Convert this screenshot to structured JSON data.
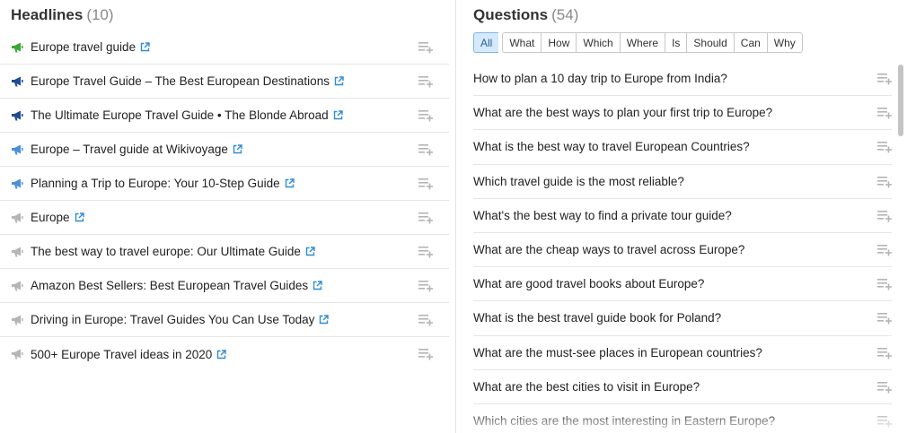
{
  "headlines": {
    "title": "Headlines",
    "count": "(10)",
    "items": [
      {
        "text": "Europe travel guide",
        "icon": "megaphone-green-icon",
        "color": "#3aa635"
      },
      {
        "text": "Europe Travel Guide – The Best European Destinations",
        "icon": "megaphone-navy-icon",
        "color": "#1f4d8f"
      },
      {
        "text": "The Ultimate Europe Travel Guide • The Blonde Abroad",
        "icon": "megaphone-navy-icon",
        "color": "#1f4d8f"
      },
      {
        "text": "Europe – Travel guide at Wikivoyage",
        "icon": "megaphone-blue-icon",
        "color": "#4a90d9"
      },
      {
        "text": "Planning a Trip to Europe: Your 10-Step Guide",
        "icon": "megaphone-blue-icon",
        "color": "#4a90d9"
      },
      {
        "text": "Europe",
        "icon": "megaphone-gray-icon",
        "color": "#b5b5b5"
      },
      {
        "text": "The best way to travel europe: Our Ultimate Guide",
        "icon": "megaphone-gray-icon",
        "color": "#b5b5b5"
      },
      {
        "text": "Amazon Best Sellers: Best European Travel Guides",
        "icon": "megaphone-gray-icon",
        "color": "#b5b5b5"
      },
      {
        "text": "Driving in Europe: Travel Guides You Can Use Today",
        "icon": "megaphone-gray-icon",
        "color": "#b5b5b5"
      },
      {
        "text": "500+ Europe Travel ideas in 2020",
        "icon": "megaphone-gray-icon",
        "color": "#b5b5b5"
      }
    ]
  },
  "questions": {
    "title": "Questions",
    "count": "(54)",
    "filters": [
      "All",
      "What",
      "How",
      "Which",
      "Where",
      "Is",
      "Should",
      "Can",
      "Why"
    ],
    "active_filter": "All",
    "items": [
      "How to plan a 10 day trip to Europe from India?",
      "What are the best ways to plan your first trip to Europe?",
      "What is the best way to travel European Countries?",
      "Which travel guide is the most reliable?",
      "What's the best way to find a private tour guide?",
      "What are the cheap ways to travel across Europe?",
      "What are good travel books about Europe?",
      "What is the best travel guide book for Poland?",
      "What are the must-see places in European countries?",
      "What are the best cities to visit in Europe?",
      "Which cities are the most interesting in Eastern Europe?"
    ]
  },
  "colors": {
    "link_icon": "#2e8bd6",
    "add_icon": "#b5b5b5",
    "active_filter_bg": "#d6e9fb"
  }
}
